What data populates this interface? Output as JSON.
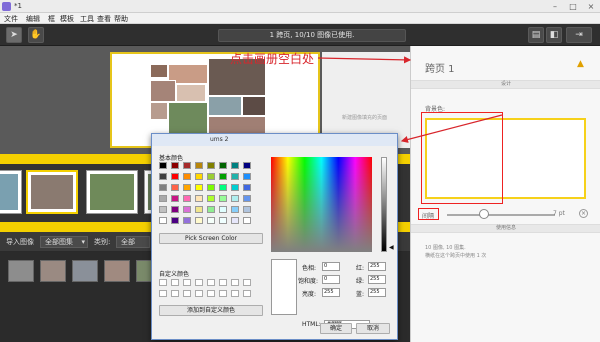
{
  "window": {
    "title": "*1"
  },
  "menu": [
    "文件",
    "编辑",
    "框",
    "模板",
    "工具",
    "查看",
    "帮助"
  ],
  "toolbar": {
    "status": "1 跨页, 10/10 图像已使用."
  },
  "annotation": {
    "text": "点击画册空白处"
  },
  "canvas": {
    "next_page_hint": "新建图像填充的页面"
  },
  "filter": {
    "import_label": "导入图像",
    "source_value": "全部图集",
    "category_label": "类别:",
    "category_value": "全部"
  },
  "right_panel": {
    "title": "跨页 1",
    "section_design": "设计",
    "bg_label": "背景色:",
    "spacing_label": "间隔",
    "spacing_value": "7 pt",
    "section_usage": "使用信息",
    "info_line1": "10 图像, 10 图集.",
    "info_line2": "横纸在这个跨页中使用 1 次",
    "swatch_color": "#f6d11a"
  },
  "color_dialog": {
    "title": "ums 2",
    "basic_colors_label": "基本颜色",
    "basic_colors": [
      "#000000",
      "#8b0000",
      "#a52a2a",
      "#b8860b",
      "#808000",
      "#006400",
      "#008080",
      "#000080",
      "#404040",
      "#ff0000",
      "#ff8c00",
      "#ffd700",
      "#9acd32",
      "#00a000",
      "#20b2aa",
      "#1e90ff",
      "#808080",
      "#ff6347",
      "#ffa500",
      "#ffff00",
      "#7cfc00",
      "#00ff7f",
      "#00ced1",
      "#4169e1",
      "#a9a9a9",
      "#c71585",
      "#ff69b4",
      "#ffe4b5",
      "#adff2f",
      "#98fb98",
      "#afeeee",
      "#6495ed",
      "#c0c0c0",
      "#800080",
      "#da70d6",
      "#f0e68c",
      "#90ee90",
      "#e0ffff",
      "#87cefa",
      "#b0c4de",
      "#ffffff",
      "#4b0082",
      "#9370db",
      "#fffacd",
      "#f5fffa",
      "#f0ffff",
      "#e6e6fa",
      "#ffffff"
    ],
    "pick_screen_label": "Pick Screen Color",
    "custom_colors_label": "自定义颜色",
    "add_custom_label": "添加到自定义颜色",
    "hue_label": "色相:",
    "hue_value": "0",
    "sat_label": "饱和度:",
    "sat_value": "0",
    "val_label": "亮度:",
    "val_value": "255",
    "red_label": "红:",
    "red_value": "255",
    "green_label": "绿:",
    "green_value": "255",
    "blue_label": "蓝:",
    "blue_value": "255",
    "html_label": "HTML:",
    "html_value": "#ffffff",
    "ok_label": "确定",
    "cancel_label": "取消"
  }
}
